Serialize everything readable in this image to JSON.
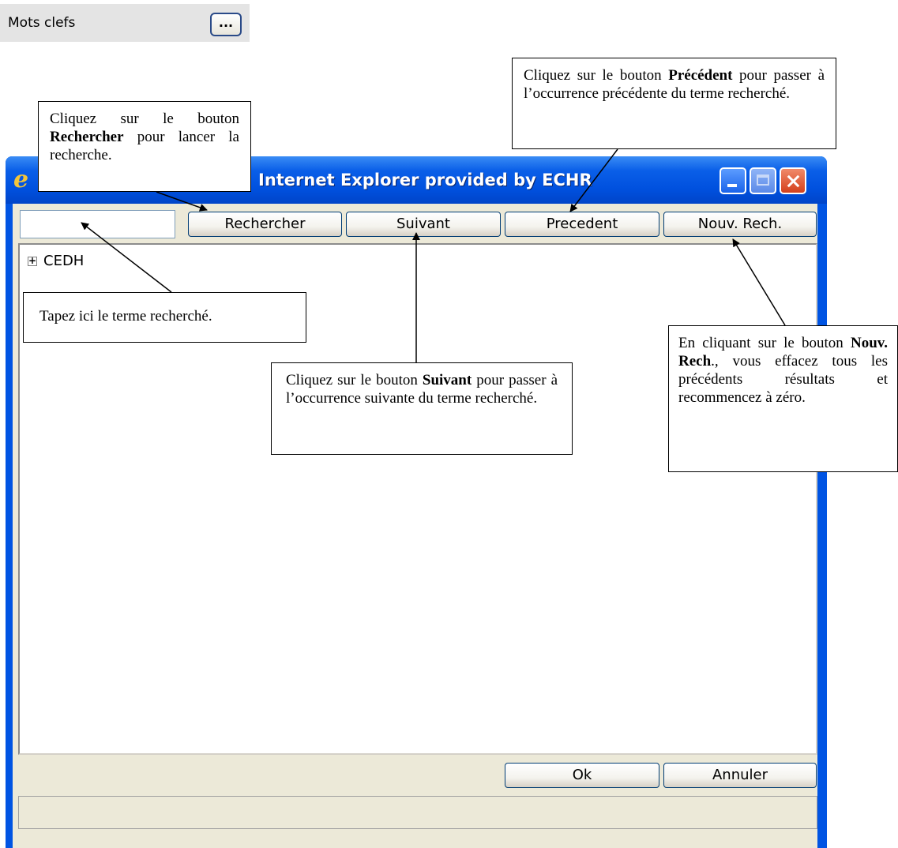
{
  "keywords_bar": {
    "label": "Mots clefs",
    "button_label": "..."
  },
  "window": {
    "title": "Internet Explorer provided by ECHR",
    "search_input": {
      "value": "",
      "placeholder": ""
    },
    "buttons": {
      "rechercher": "Rechercher",
      "suivant": "Suivant",
      "precedent": "Precedent",
      "nouv_rech": "Nouv. Rech.",
      "ok": "Ok",
      "annuler": "Annuler"
    },
    "tree": {
      "items": [
        {
          "label": "CEDH",
          "expander": "+"
        }
      ]
    },
    "status_text": ""
  },
  "callouts": {
    "rechercher": {
      "t1": "Cliquez sur le bouton ",
      "b1": "Rechercher",
      "t2": " pour lancer la recherche."
    },
    "precedent": {
      "t1": "Cliquez sur le bouton ",
      "b1": "Précédent",
      "t2": " pour passer à l’occurrence précédente du terme recherché."
    },
    "tapez": {
      "text": "Tapez ici le terme recherché."
    },
    "suivant": {
      "t1": "Cliquez sur le bouton ",
      "b1": "Suivant",
      "t2": " pour passer à l’occurrence suivante du terme recherché."
    },
    "nouv_rech": {
      "t1": "En cliquant sur le bouton ",
      "b1": "Nouv. Rech",
      "t2": "., vous effacez tous les précédents résultats et recommencez à zéro."
    }
  },
  "colors": {
    "titlebar": "#0054e3",
    "client_background": "#ece9d8",
    "button_border": "#003c74"
  },
  "icons": {
    "window_icon": "internet-explorer-icon",
    "minimize": "minimize-icon",
    "maximize": "maximize-icon",
    "close": "close-icon",
    "tree_expander": "plus-box-icon"
  }
}
